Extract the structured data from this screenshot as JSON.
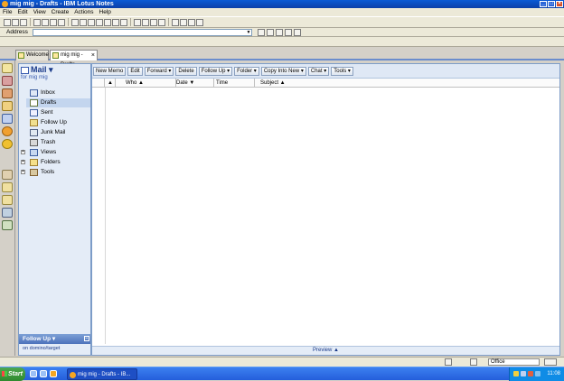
{
  "window": {
    "title": "mig mig - Drafts - IBM Lotus Notes",
    "minimize": "_",
    "maximize": "□",
    "close": "×"
  },
  "menu": [
    "File",
    "Edit",
    "View",
    "Create",
    "Actions",
    "Help"
  ],
  "address": {
    "label": "Address",
    "value": ""
  },
  "tabs": [
    {
      "label": "Welcome",
      "icon": "home-icon"
    },
    {
      "label": "mig mig - Drafts",
      "icon": "mail-icon",
      "close": "×"
    }
  ],
  "nav": {
    "title": "Mail",
    "subtitle": "for mig mig",
    "items": [
      {
        "label": "Inbox",
        "icon": "inbox-icon"
      },
      {
        "label": "Drafts",
        "icon": "drafts-icon",
        "selected": true
      },
      {
        "label": "Sent",
        "icon": "sent-icon"
      },
      {
        "label": "Follow Up",
        "icon": "followup-icon"
      },
      {
        "label": "Junk Mail",
        "icon": "junk-icon"
      },
      {
        "label": "Trash",
        "icon": "trash-icon"
      },
      {
        "label": "Views",
        "icon": "views-icon",
        "expander": "+"
      },
      {
        "label": "Folders",
        "icon": "folder-icon",
        "expander": "+"
      },
      {
        "label": "Tools",
        "icon": "tools-icon",
        "expander": "+"
      }
    ],
    "followup_panel": "Follow Up",
    "followup_collapse": "−",
    "server": "on domino/target"
  },
  "actions": [
    "New Memo",
    "Edit",
    "Forward",
    "Delete",
    "Follow Up",
    "Folder",
    "Copy Into New",
    "Chat",
    "Tools"
  ],
  "columns": [
    "Who",
    "Date",
    "Time",
    "Subject"
  ],
  "preview": "Preview",
  "status": {
    "location": "Office"
  },
  "taskbar": {
    "start": "Start",
    "item": "mig mig - Drafts - IB...",
    "clock": "11:08"
  },
  "colors": {
    "accent": "#1a3a8a",
    "nav_bg": "#e4ecf7",
    "selected": "#c3d5ee"
  }
}
